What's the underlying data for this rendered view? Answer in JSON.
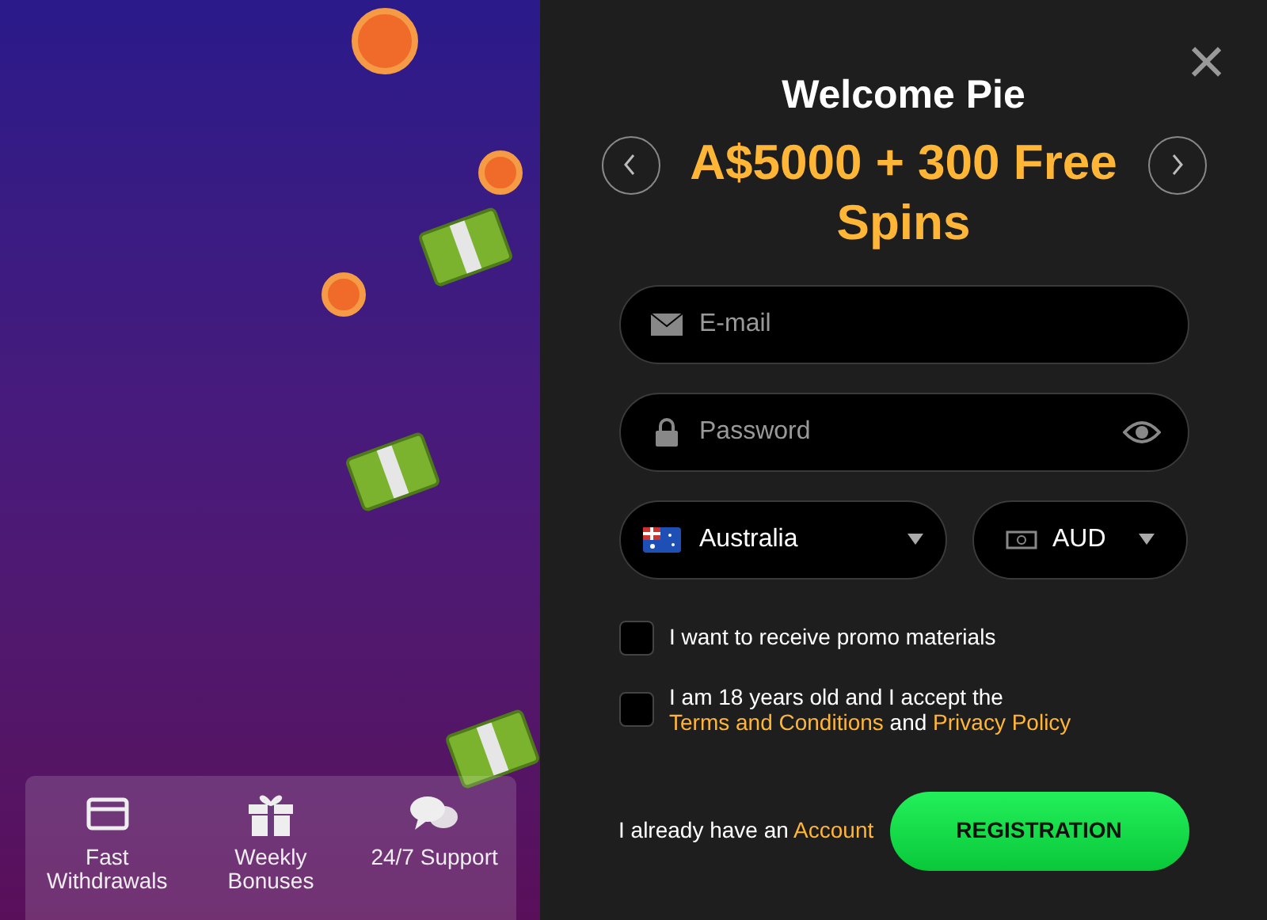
{
  "features": [
    {
      "kind": "card",
      "label": "Fast\nWithdrawals"
    },
    {
      "kind": "gift",
      "label": "Weekly\nBonuses"
    },
    {
      "kind": "chat",
      "label": "24/7 Support"
    }
  ],
  "modal": {
    "close": "×",
    "title": "Welcome Pie",
    "bonus": "A$5000 + 300 Free Spins",
    "email": {
      "placeholder": "E-mail"
    },
    "password": {
      "placeholder": "Password"
    },
    "country": {
      "value": "Australia"
    },
    "currency": {
      "value": "AUD"
    },
    "promo": {
      "checked": false,
      "text": "I want to receive promo materials"
    },
    "terms": {
      "checked": false,
      "text": "I am 18 years old and I accept the",
      "terms_link": "Terms and Conditions",
      "middle": "and",
      "privacy_link": "Privacy Policy"
    },
    "login": {
      "text": "I already have an",
      "link": "Account"
    },
    "register": "REGISTRATION"
  }
}
